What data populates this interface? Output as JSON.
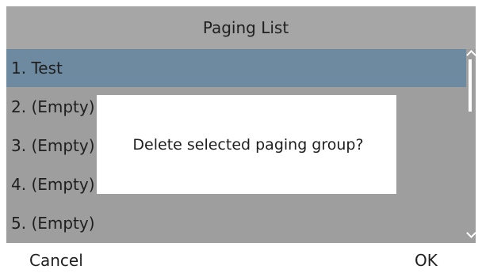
{
  "title": "Paging List",
  "list": {
    "items": [
      {
        "label": "1. Test",
        "selected": true
      },
      {
        "label": "2. (Empty)",
        "selected": false
      },
      {
        "label": "3. (Empty)",
        "selected": false
      },
      {
        "label": "4. (Empty)",
        "selected": false
      },
      {
        "label": "5. (Empty)",
        "selected": false
      }
    ]
  },
  "dialog": {
    "message": "Delete selected paging group?"
  },
  "softkeys": {
    "left": "Cancel",
    "right": "OK"
  },
  "colors": {
    "title_bar": "#a6a6a6",
    "list_background": "#9e9e9e",
    "selected_row": "#6d8aa1",
    "dialog_background": "#ffffff",
    "text": "#1f1f1f"
  },
  "icons": {
    "scroll_up": "chevron-up-icon",
    "scroll_down": "chevron-down-icon"
  }
}
